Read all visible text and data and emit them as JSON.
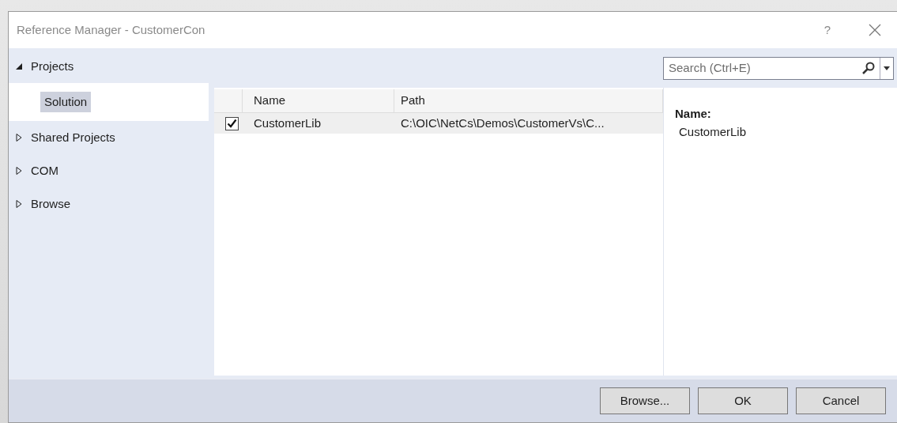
{
  "window": {
    "title": "Reference Manager - CustomerCon",
    "help": "?"
  },
  "sidebar": {
    "items": [
      {
        "label": "Projects",
        "expanded": true,
        "children": [
          {
            "label": "Solution",
            "selected": true
          }
        ]
      },
      {
        "label": "Shared Projects",
        "expanded": false
      },
      {
        "label": "COM",
        "expanded": false
      },
      {
        "label": "Browse",
        "expanded": false
      }
    ]
  },
  "search": {
    "placeholder": "Search (Ctrl+E)"
  },
  "table": {
    "columns": [
      "Name",
      "Path"
    ],
    "rows": [
      {
        "checked": true,
        "selected": true,
        "name": "CustomerLib",
        "path": "C:\\OIC\\NetCs\\Demos\\CustomerVs\\C..."
      }
    ]
  },
  "details": {
    "label": "Name:",
    "value": "CustomerLib"
  },
  "buttons": [
    "Browse...",
    "OK",
    "Cancel"
  ]
}
